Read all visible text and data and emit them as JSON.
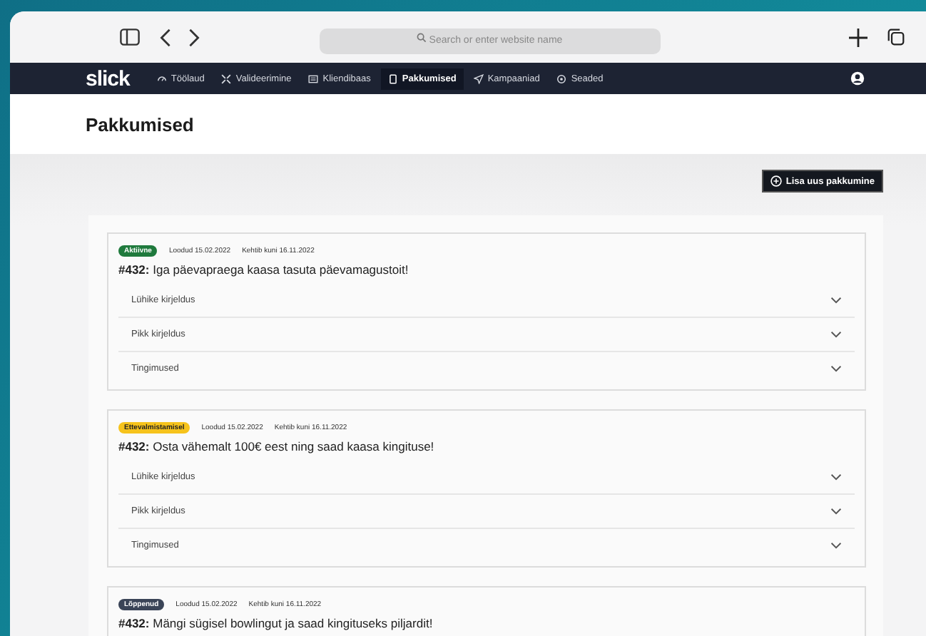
{
  "browser": {
    "address_placeholder": "Search or enter website name"
  },
  "nav": {
    "logo": "slick",
    "items": [
      {
        "label": "Töölaud",
        "selected": false
      },
      {
        "label": "Valideerimine",
        "selected": false
      },
      {
        "label": "Kliendibaas",
        "selected": false
      },
      {
        "label": "Pakkumised",
        "selected": true
      },
      {
        "label": "Kampaaniad",
        "selected": false
      },
      {
        "label": "Seaded",
        "selected": false
      }
    ]
  },
  "page": {
    "title": "Pakkumised",
    "add_button": "Lisa uus pakkumine"
  },
  "offers": [
    {
      "status": "Aktiivne",
      "color": "#1f7a3d",
      "created": "Loodud 15.02.2022",
      "valid": "Kehtib kuni 16.11.2022",
      "title": "**#432:** Iga päevapraega kaasa tasuta päevamagustoit!",
      "sections": [
        {
          "label": "Lühike kirjeldus",
          "expanded": false
        },
        {
          "label": "Pikk kirjeldus",
          "expanded": false
        },
        {
          "label": "Tingimused",
          "expanded": false
        }
      ]
    },
    {
      "status": "Ettevalmistamisel",
      "color": "#f6c31c",
      "created": "Loodud 15.02.2022",
      "valid": "Kehtib kuni 16.11.2022",
      "title": "**#432:** Osta vähemalt 100€ eest ning saad kaasa kingituse!",
      "sections": [
        {
          "label": "Lühike kirjeldus",
          "expanded": false
        },
        {
          "label": "Pikk kirjeldus",
          "expanded": false
        },
        {
          "label": "Tingimused",
          "expanded": false
        }
      ]
    },
    {
      "status": "Lõppenud",
      "color": "#3a4457",
      "created": "Loodud 15.02.2022",
      "valid": "Kehtib kuni 16.11.2022",
      "title": "**#432:** Mängi sügisel bowlingut ja saad kingituseks piljardit!"
    }
  ]
}
